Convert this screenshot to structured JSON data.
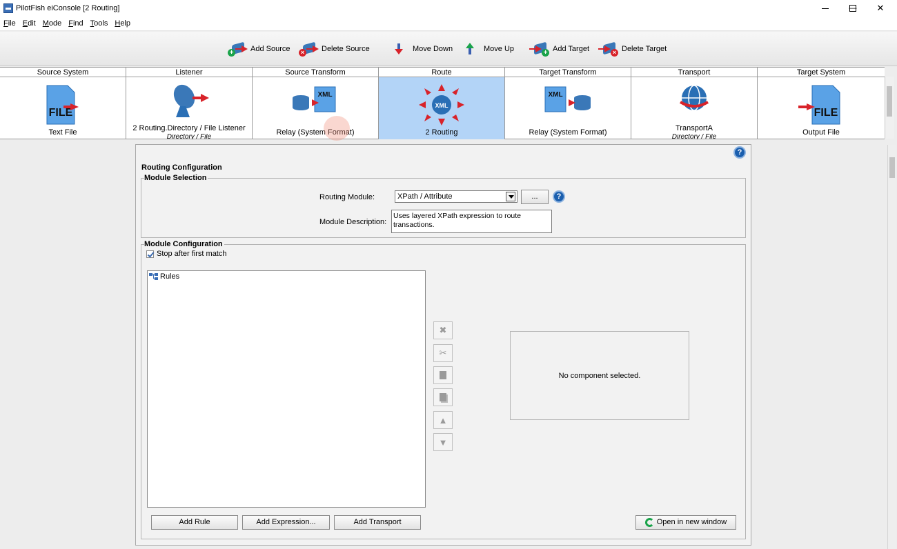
{
  "window": {
    "title": "PilotFish eiConsole [2 Routing]",
    "controls": {
      "minimize": "—",
      "maximize": "☐",
      "close": "✕"
    }
  },
  "menu": [
    {
      "label": "File",
      "u": "F",
      "rest": "ile"
    },
    {
      "label": "Edit",
      "u": "E",
      "rest": "dit"
    },
    {
      "label": "Mode",
      "u": "M",
      "rest": "ode"
    },
    {
      "label": "Find",
      "u": "F",
      "rest": "ind"
    },
    {
      "label": "Tools",
      "u": "T",
      "rest": "ools"
    },
    {
      "label": "Help",
      "u": "H",
      "rest": "elp"
    }
  ],
  "toolbar": {
    "add_source": "Add Source",
    "delete_source": "Delete Source",
    "move_down": "Move Down",
    "move_up": "Move Up",
    "add_target": "Add Target",
    "delete_target": "Delete Target"
  },
  "stages": [
    {
      "header": "Source System",
      "label": "Text File",
      "sub": "",
      "icon": "file-icon"
    },
    {
      "header": "Listener",
      "label": "2 Routing.Directory / File Listener",
      "sub": "Directory / File",
      "icon": "satellite-dish-icon"
    },
    {
      "header": "Source Transform",
      "label": "Relay (System Format)",
      "sub": "",
      "icon": "xml-transform-icon"
    },
    {
      "header": "Route",
      "label": "2 Routing",
      "sub": "",
      "icon": "xml-route-icon",
      "selected": true
    },
    {
      "header": "Target Transform",
      "label": "Relay (System Format)",
      "sub": "",
      "icon": "xml-transform-icon"
    },
    {
      "header": "Transport",
      "label": "TransportA",
      "sub": "Directory / File",
      "icon": "globe-icon"
    },
    {
      "header": "Target System",
      "label": "Output File",
      "sub": "",
      "icon": "file-icon"
    }
  ],
  "routing": {
    "section_title": "Routing Configuration",
    "module_selection_title": "Module Selection",
    "routing_module_label": "Routing Module:",
    "routing_module_value": "XPath / Attribute",
    "browse_label": "...",
    "module_description_label": "Module Description:",
    "module_description": "Uses layered XPath expression to route transactions.",
    "module_configuration_title": "Module Configuration",
    "stop_after_first_match": "Stop after first match",
    "stop_after_first_match_checked": true,
    "tree_root": "Rules",
    "no_component": "No component selected.",
    "buttons": {
      "add_rule": "Add Rule",
      "add_expression": "Add Expression...",
      "add_transport": "Add Transport",
      "open_new_window": "Open in new window"
    },
    "side_buttons": [
      "delete",
      "cut",
      "copy",
      "paste",
      "move-up",
      "move-down"
    ]
  },
  "help_glyph": "?",
  "file_label": "FILE",
  "xml_label": "XML"
}
